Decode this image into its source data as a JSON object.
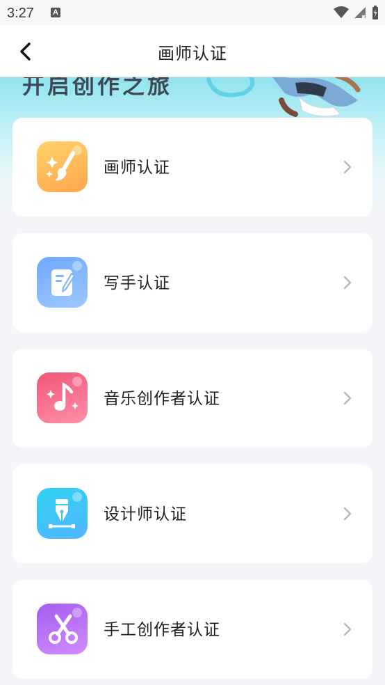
{
  "status_bar": {
    "time": "3:27",
    "notification_badge": "A"
  },
  "header": {
    "title": "画师认证"
  },
  "banner": {
    "slogan": "开启创作之旅"
  },
  "certifications": [
    {
      "label": "画师认证",
      "icon": "paintbrush-sparkle-icon",
      "gradient": [
        "#ffd36b",
        "#ffa64d"
      ]
    },
    {
      "label": "写手认证",
      "icon": "document-pen-icon",
      "gradient": [
        "#6fa8ff",
        "#9ec9ff"
      ]
    },
    {
      "label": "音乐创作者认证",
      "icon": "music-note-icon",
      "gradient": [
        "#f25577",
        "#ff8fa8"
      ]
    },
    {
      "label": "设计师认证",
      "icon": "pen-nib-icon",
      "gradient": [
        "#2ed3f2",
        "#53b5ff"
      ]
    },
    {
      "label": "手工创作者认证",
      "icon": "scissors-icon",
      "gradient": [
        "#a65cf0",
        "#cf8cff"
      ]
    }
  ]
}
